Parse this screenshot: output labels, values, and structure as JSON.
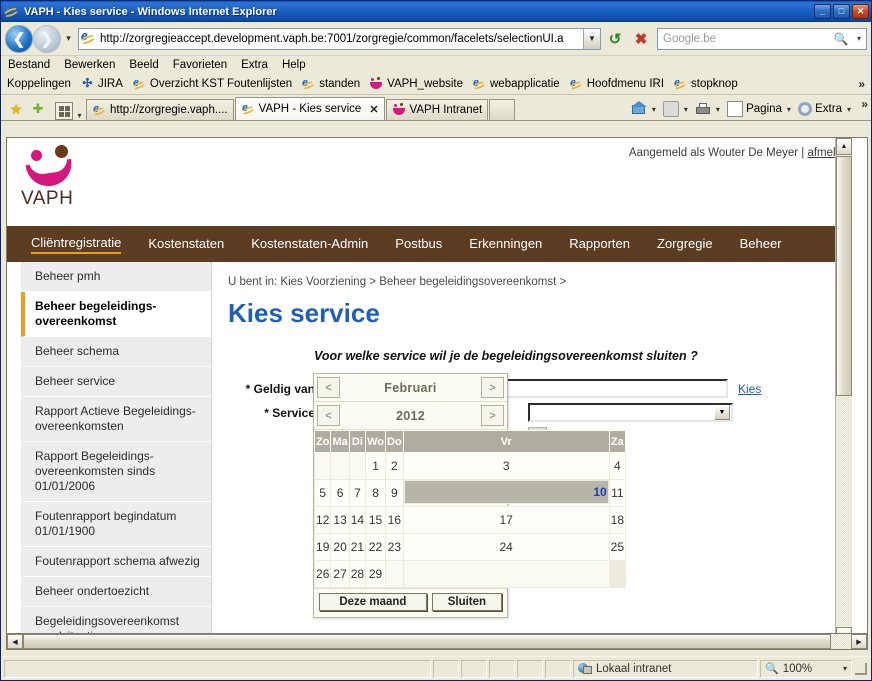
{
  "window": {
    "title": "VAPH - Kies service - Windows Internet Explorer",
    "minimize": "_",
    "maximize": "□",
    "close": "✕"
  },
  "addressbar": {
    "back_icon": "back-arrow-icon",
    "forward_icon": "forward-arrow-icon",
    "url": "http://zorgregieaccept.development.vaph.be:7001/zorgregie/common/facelets/selectionUI.a",
    "refresh_icon": "refresh-icon",
    "stop_icon": "stop-icon",
    "search_placeholder": "Google.be"
  },
  "menubar": {
    "items": [
      {
        "label": "Bestand",
        "accel": "B"
      },
      {
        "label": "Bewerken",
        "accel": "B"
      },
      {
        "label": "Beeld",
        "accel": "B"
      },
      {
        "label": "Favorieten",
        "accel": "F"
      },
      {
        "label": "Extra",
        "accel": "x"
      },
      {
        "label": "Help",
        "accel": "H"
      }
    ]
  },
  "linksbar": {
    "title": "Koppelingen",
    "items": [
      {
        "label": "JIRA",
        "icon": "jira-icon"
      },
      {
        "label": "Overzicht KST Foutenlijsten",
        "icon": "ie-icon"
      },
      {
        "label": "standen",
        "icon": "ie-icon"
      },
      {
        "label": "VAPH_website",
        "icon": "vaph-icon"
      },
      {
        "label": "webapplicatie",
        "icon": "ie-icon"
      },
      {
        "label": "Hoofdmenu IRI",
        "icon": "ie-icon"
      },
      {
        "label": "stopknop",
        "icon": "ie-icon"
      }
    ],
    "overflow": "»"
  },
  "tabbar": {
    "tabs": [
      {
        "label": "http://zorgregie.vaph....",
        "icon": "ie-icon",
        "active": false
      },
      {
        "label": "VAPH - Kies service",
        "icon": "ie-icon",
        "active": true,
        "close": "✕"
      },
      {
        "label": "VAPH Intranet",
        "icon": "vaph-icon",
        "active": false
      }
    ],
    "tools": [
      {
        "label": "",
        "icon": "home-icon"
      },
      {
        "label": "",
        "icon": "rss-icon"
      },
      {
        "label": "",
        "icon": "print-icon"
      },
      {
        "label": "Pagina",
        "icon": "page-icon"
      },
      {
        "label": "Extra",
        "icon": "gear-icon"
      }
    ],
    "overflow": "»"
  },
  "site": {
    "logo_text": "VAPH",
    "login_prefix": "Aangemeld als Wouter De Meyer | ",
    "login_user": "Wouter De Meyer",
    "logout_label": "afmeld",
    "nav": [
      {
        "label": "Cliëntregistratie",
        "active": true
      },
      {
        "label": "Kostenstaten",
        "active": false
      },
      {
        "label": "Kostenstaten-Admin",
        "active": false
      },
      {
        "label": "Postbus",
        "active": false
      },
      {
        "label": "Erkenningen",
        "active": false
      },
      {
        "label": "Rapporten",
        "active": false
      },
      {
        "label": "Zorgregie",
        "active": false
      },
      {
        "label": "Beheer",
        "active": false
      }
    ]
  },
  "sidebar": {
    "items": [
      {
        "label": "Beheer pmh",
        "active": false
      },
      {
        "label": "Beheer begeleidings-overeenkomst",
        "active": true
      },
      {
        "label": "Beheer schema",
        "active": false
      },
      {
        "label": "Beheer service",
        "active": false
      },
      {
        "label": "Rapport Actieve Begeleidings-overeenkomsten",
        "active": false
      },
      {
        "label": "Rapport Begeleidings-overeenkomsten sinds 01/01/2006",
        "active": false
      },
      {
        "label": "Foutenrapport begindatum 01/01/1900",
        "active": false
      },
      {
        "label": "Foutenrapport schema afwezig",
        "active": false
      },
      {
        "label": "Beheer ondertoezicht",
        "active": false
      },
      {
        "label": "Begeleidingsovereenkomst noodsituatie",
        "active": false
      }
    ]
  },
  "main": {
    "breadcrumb": "U bent in: Kies Voorziening > Beheer begeleidingsovereenkomst >",
    "title": "Kies service",
    "question": "Voor welke service wil je de begeleidingsovereenkomst sluiten ?",
    "fields": [
      {
        "label": "* Geldig van",
        "value": "",
        "link": "Kies"
      },
      {
        "label": "* Service",
        "value": ""
      }
    ],
    "geldig_van_label": "* Geldig van",
    "geldig_van_value": "",
    "kies_link": "Kies",
    "service_label": "* Service",
    "service_value": ""
  },
  "calendar": {
    "month": "Februari",
    "year": "2012",
    "prev_icon": "<",
    "next_icon": ">",
    "weekdays": [
      "Zo",
      "Ma",
      "Di",
      "Wo",
      "Do",
      "Vr",
      "Za"
    ],
    "weeks": [
      [
        "",
        "",
        "",
        "1",
        "2",
        "3",
        "4"
      ],
      [
        "5",
        "6",
        "7",
        "8",
        "9",
        "10",
        "11"
      ],
      [
        "12",
        "13",
        "14",
        "15",
        "16",
        "17",
        "18"
      ],
      [
        "19",
        "20",
        "21",
        "22",
        "23",
        "24",
        "25"
      ],
      [
        "26",
        "27",
        "28",
        "29",
        "",
        "",
        ""
      ]
    ],
    "selected_day": "10",
    "today_button": "Deze maand",
    "close_button": "Sluiten"
  },
  "statusbar": {
    "message": "",
    "zone": "Lokaal intranet",
    "zoom": "100%",
    "zoom_caret": "▾"
  },
  "colors": {
    "nav_brown": "#5c3d21",
    "accent_orange": "#f09a1e",
    "brand_magenta": "#d6177e",
    "title_blue": "#1f5fb4",
    "titlebar_blue": "#1e63c4"
  }
}
